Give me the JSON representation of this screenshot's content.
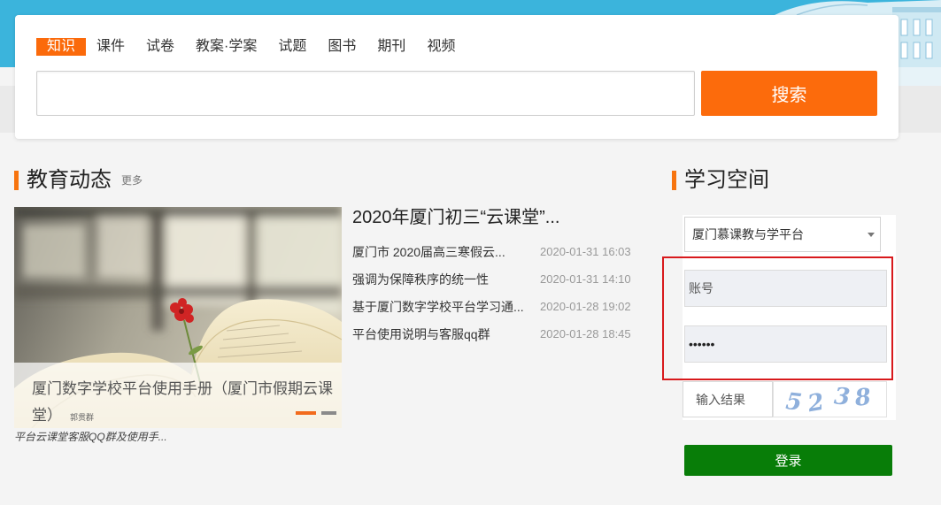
{
  "search": {
    "tabs": [
      {
        "label": "知识",
        "active": true
      },
      {
        "label": "课件",
        "active": false
      },
      {
        "label": "试卷",
        "active": false
      },
      {
        "label": "教案·学案",
        "active": false
      },
      {
        "label": "试题",
        "active": false
      },
      {
        "label": "图书",
        "active": false
      },
      {
        "label": "期刊",
        "active": false
      },
      {
        "label": "视频",
        "active": false
      }
    ],
    "input_value": "",
    "button_label": "搜索"
  },
  "news": {
    "title": "教育动态",
    "more": "更多",
    "slider": {
      "caption": "厦门数字学校平台使用手册（厦门市假期云课堂）",
      "photo_text": "郭贯群",
      "subcaption": "平台云课堂客服QQ群及使用手...",
      "slide_count": 2,
      "active_slide": 1
    },
    "headline": "2020年厦门初三“云课堂”...",
    "items": [
      {
        "title": "厦门市 2020届高三寒假云...",
        "date": "2020-01-31 16:03"
      },
      {
        "title": "强调为保障秩序的统一性",
        "date": "2020-01-31 14:10"
      },
      {
        "title": "基于厦门数字学校平台学习通...",
        "date": "2020-01-28 19:02"
      },
      {
        "title": "平台使用说明与客服qq群",
        "date": "2020-01-28 18:45"
      }
    ]
  },
  "login": {
    "title": "学习空间",
    "platform_selected": "厦门慕课教与学平台",
    "account_placeholder": "账号",
    "password_value": "••••••",
    "captcha_placeholder": "输入结果",
    "captcha_digits": [
      "5",
      "2",
      "3",
      "8"
    ],
    "button_label": "登录"
  },
  "icons": {
    "select_arrow": "caret-down-icon"
  },
  "colors": {
    "banner": "#3bb4dc",
    "accent_orange": "#fb6a0b",
    "login_green": "#087d08",
    "highlight_red": "#d8191c"
  }
}
